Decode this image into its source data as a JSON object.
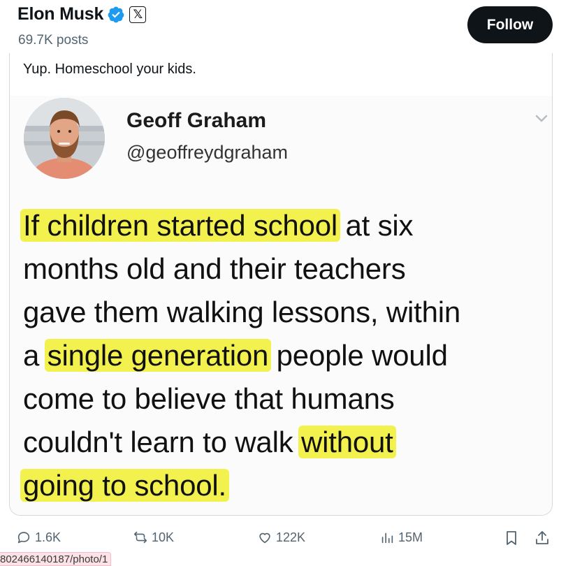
{
  "header": {
    "profile_name": "Elon Musk",
    "post_count": "69.7K posts",
    "follow_label": "Follow",
    "x_badge": "𝕏",
    "verified_color": "#1d9bf0"
  },
  "post": {
    "text": "Yup. Homeschool your kids."
  },
  "quoted_image": {
    "author_name": "Geoff Graham",
    "author_handle": "@geoffreydgraham",
    "highlight_color": "#f3f14e",
    "lines": [
      [
        {
          "t": "If children started school",
          "hl": true
        },
        {
          "t": " at six",
          "hl": false
        }
      ],
      [
        {
          "t": "months old and their teachers",
          "hl": false
        }
      ],
      [
        {
          "t": "gave them walking lessons, within",
          "hl": false
        }
      ],
      [
        {
          "t": "a ",
          "hl": false
        },
        {
          "t": "single generation",
          "hl": true
        },
        {
          "t": " people would",
          "hl": false
        }
      ],
      [
        {
          "t": "come to believe that humans",
          "hl": false
        }
      ],
      [
        {
          "t": "couldn't learn to walk ",
          "hl": false
        },
        {
          "t": "without",
          "hl": true
        }
      ],
      [
        {
          "t": "going to school.",
          "hl": true
        }
      ]
    ]
  },
  "actions": {
    "replies": "1.6K",
    "reposts": "10K",
    "likes": "122K",
    "views": "15M",
    "icons": [
      "reply-icon",
      "repost-icon",
      "like-icon",
      "views-icon",
      "bookmark-icon",
      "share-icon"
    ]
  },
  "status_bar": {
    "url": "802466140187/photo/1"
  }
}
